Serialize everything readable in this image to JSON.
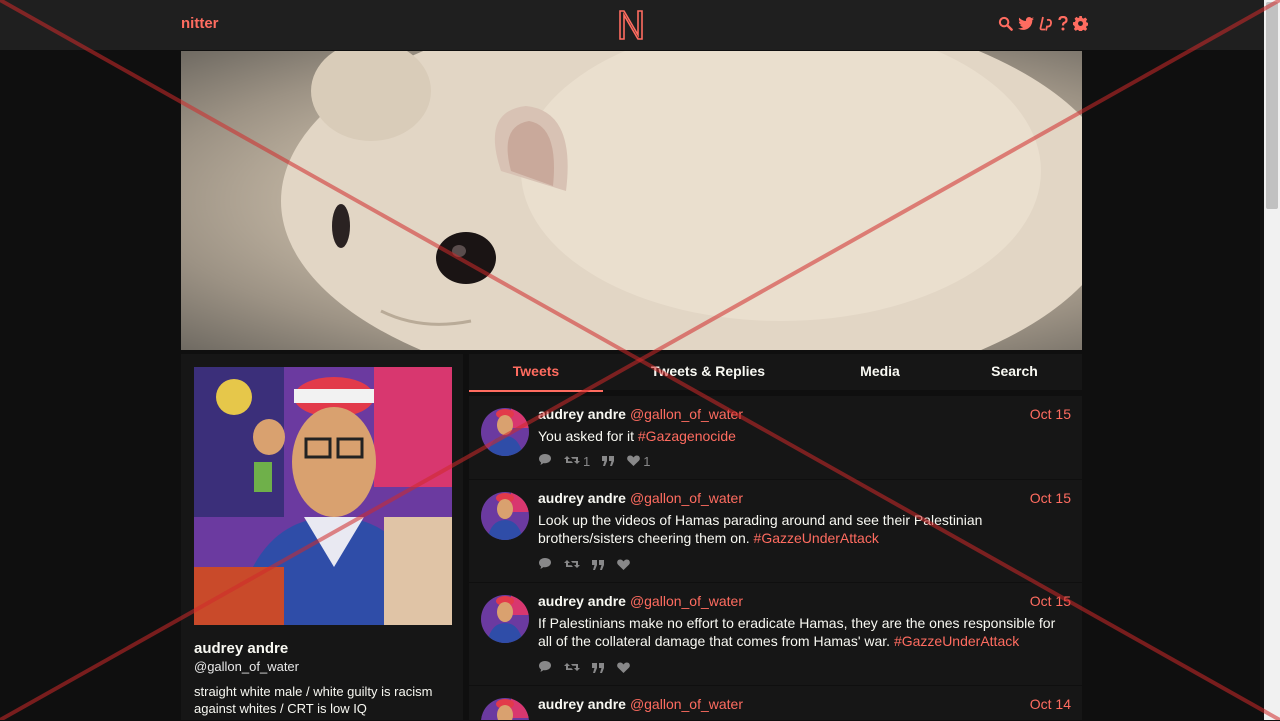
{
  "brand": "nitter",
  "colors": {
    "accent": "#ff6c60",
    "background": "#0f0f0f",
    "panel": "#161616",
    "muted": "#888889"
  },
  "nav_icons": [
    "search-icon",
    "twitter-icon",
    "liberapay-icon",
    "help-icon",
    "gear-icon"
  ],
  "profile": {
    "fullname": "audrey andre",
    "username": "@gallon_of_water",
    "bio": "straight white male / white guilty is racism against whites / CRT is low IQ"
  },
  "tabs": [
    "Tweets",
    "Tweets & Replies",
    "Media",
    "Search"
  ],
  "tweets": [
    {
      "name": "audrey andre",
      "user": "@gallon_of_water",
      "date": "Oct 15",
      "text": "You asked for it ",
      "hashtag": "#Gazagenocide",
      "retweets": "1",
      "likes": "1"
    },
    {
      "name": "audrey andre",
      "user": "@gallon_of_water",
      "date": "Oct 15",
      "text": "Look up the videos of Hamas parading around and see their Palestinian brothers/sisters cheering them on.  ",
      "hashtag": "#GazzeUnderAttack",
      "retweets": "",
      "likes": ""
    },
    {
      "name": "audrey andre",
      "user": "@gallon_of_water",
      "date": "Oct 15",
      "text": "If Palestinians make no effort to eradicate Hamas, they are the ones responsible for all of the collateral damage that comes from Hamas' war.  ",
      "hashtag": "#GazzeUnderAttack",
      "retweets": "",
      "likes": ""
    },
    {
      "name": "audrey andre",
      "user": "@gallon_of_water",
      "date": "Oct 14",
      "text": "",
      "hashtag": "",
      "retweets": "",
      "likes": ""
    }
  ]
}
